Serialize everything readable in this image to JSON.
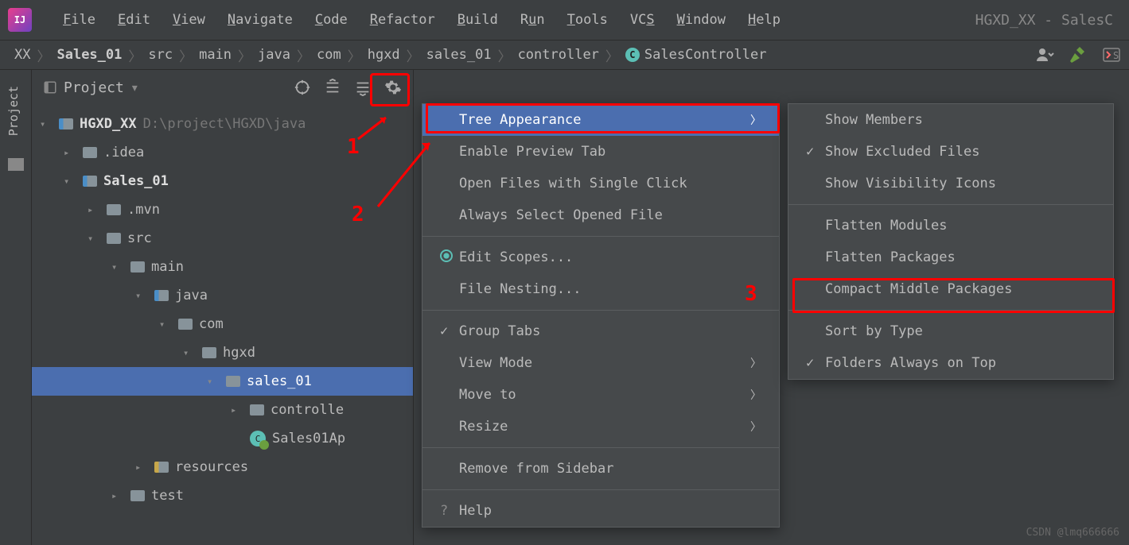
{
  "app_icon": "IJ",
  "menubar": {
    "file": "File",
    "edit": "Edit",
    "view": "View",
    "navigate": "Navigate",
    "code": "Code",
    "refactor": "Refactor",
    "build": "Build",
    "run": "Run",
    "tools": "Tools",
    "vcs": "VCS",
    "window": "Window",
    "help": "Help"
  },
  "title_right": "HGXD_XX - SalesC",
  "breadcrumb": {
    "items": [
      "XX",
      "Sales_01",
      "src",
      "main",
      "java",
      "com",
      "hgxd",
      "sales_01",
      "controller",
      "SalesController"
    ]
  },
  "sidebar_tab": "Project",
  "panel": {
    "title": "Project"
  },
  "tree": {
    "root": {
      "name": "HGXD_XX",
      "path": "D:\\project\\HGXD\\java"
    },
    "idea": ".idea",
    "sales": "Sales_01",
    "mvn": ".mvn",
    "src": "src",
    "main": "main",
    "java": "java",
    "com": "com",
    "hgxd": "hgxd",
    "sales01": "sales_01",
    "controller": "controlle",
    "sales01app": "Sales01Ap",
    "resources": "resources",
    "test": "test"
  },
  "menu1": {
    "tree_appearance": "Tree Appearance",
    "enable_preview": "Enable Preview Tab",
    "open_single_click": "Open Files with Single Click",
    "always_select": "Always Select Opened File",
    "edit_scopes": "Edit Scopes...",
    "file_nesting": "File Nesting...",
    "group_tabs": "Group Tabs",
    "view_mode": "View Mode",
    "move_to": "Move to",
    "resize": "Resize",
    "remove_sidebar": "Remove from Sidebar",
    "help": "Help"
  },
  "menu2": {
    "show_members": "Show Members",
    "show_excluded": "Show Excluded Files",
    "show_visibility": "Show Visibility Icons",
    "flatten_modules": "Flatten Modules",
    "flatten_packages": "Flatten Packages",
    "compact_middle": "Compact Middle Packages",
    "sort_by_type": "Sort by Type",
    "folders_top": "Folders Always on Top"
  },
  "annotations": {
    "a1": "1",
    "a2": "2",
    "a3": "3"
  },
  "watermark": "CSDN @lmq666666"
}
